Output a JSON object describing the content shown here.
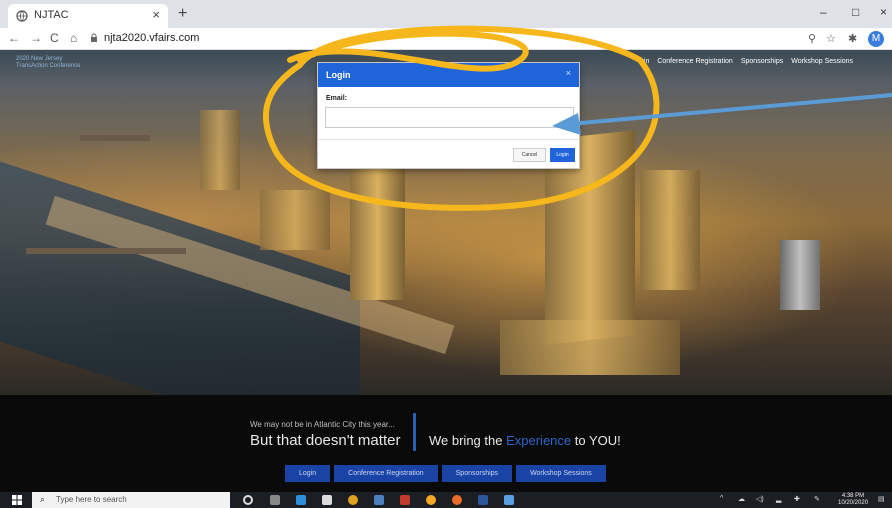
{
  "browser": {
    "tab_title": "NJTAC",
    "tab_close": "×",
    "new_tab": "+",
    "url": "njta2020.vfairs.com",
    "min": "–",
    "max": "□",
    "close": "×",
    "profile_initial": "M"
  },
  "site": {
    "brand_line1": "2020 New Jersey",
    "brand_line2": "TransAction Conference",
    "nav": [
      "gin",
      "Conference Registration",
      "Sponsorships",
      "Workshop Sessions"
    ]
  },
  "modal": {
    "title": "Login",
    "close": "×",
    "email_label": "Email:",
    "email_value": "",
    "cancel": "Cancel",
    "login": "Login"
  },
  "footer": {
    "tagline_small": "We may not be in Atlantic City this year...",
    "tagline_big": "But that doesn't matter",
    "tagline_right_pre": "We bring the ",
    "tagline_right_hl": "Experience",
    "tagline_right_post": " to YOU!",
    "nav": [
      "Login",
      "Conference Registration",
      "Sponsorships",
      "Workshop Sessions"
    ]
  },
  "taskbar": {
    "search_placeholder": "Type here to search",
    "time": "4:38 PM",
    "date": "10/20/2020"
  },
  "colors": {
    "annotation_ellipse": "#f5b71c",
    "annotation_arrow": "#5b9bd5",
    "accent": "#1f64d9"
  }
}
